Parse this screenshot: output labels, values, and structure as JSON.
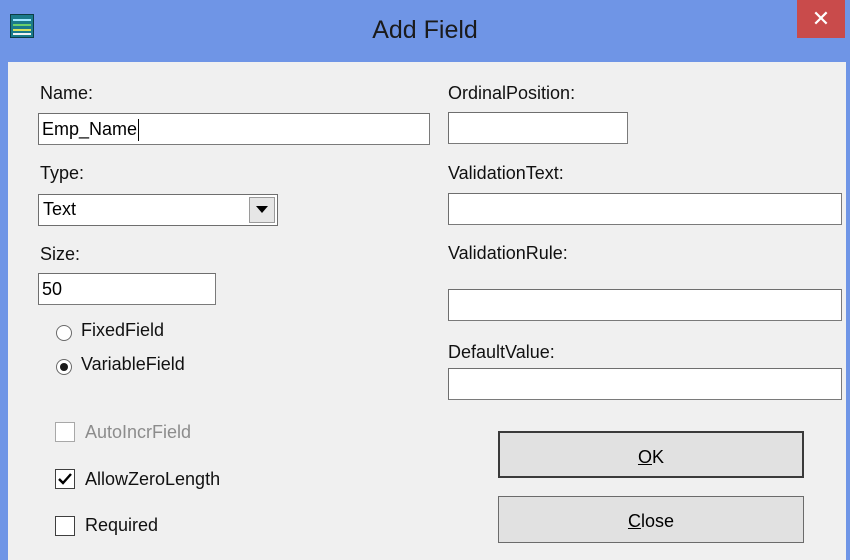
{
  "window": {
    "title": "Add Field",
    "close_glyph": "✕"
  },
  "fields": {
    "name": {
      "label": "Name:",
      "value": "Emp_Name"
    },
    "type": {
      "label": "Type:",
      "value": "Text"
    },
    "size": {
      "label": "Size:",
      "value": "50"
    },
    "ordinal_position": {
      "label": "OrdinalPosition:",
      "value": ""
    },
    "validation_text": {
      "label": "ValidationText:",
      "value": ""
    },
    "validation_rule": {
      "label": "ValidationRule:",
      "value": ""
    },
    "default_value": {
      "label": "DefaultValue:",
      "value": ""
    }
  },
  "radios": {
    "fixed_field": {
      "label": "FixedField",
      "selected": false
    },
    "variable_field": {
      "label": "VariableField",
      "selected": true
    }
  },
  "checkboxes": {
    "auto_incr": {
      "label": "AutoIncrField",
      "checked": false,
      "enabled": false
    },
    "allow_zero_length": {
      "label": "AllowZeroLength",
      "checked": true,
      "enabled": true
    },
    "required": {
      "label": "Required",
      "checked": false,
      "enabled": true
    }
  },
  "buttons": {
    "ok": {
      "mnemonic": "O",
      "rest": "K"
    },
    "close": {
      "mnemonic": "C",
      "rest": "lose"
    }
  },
  "icons": {
    "app": "app-icon",
    "close": "close-icon",
    "dropdown": "chevron-down-icon",
    "checkmark": "checkmark-icon"
  },
  "colors": {
    "title_bar": "#6f95e6",
    "close_button": "#c94b4b",
    "dialog_background": "#f0f0f0"
  }
}
